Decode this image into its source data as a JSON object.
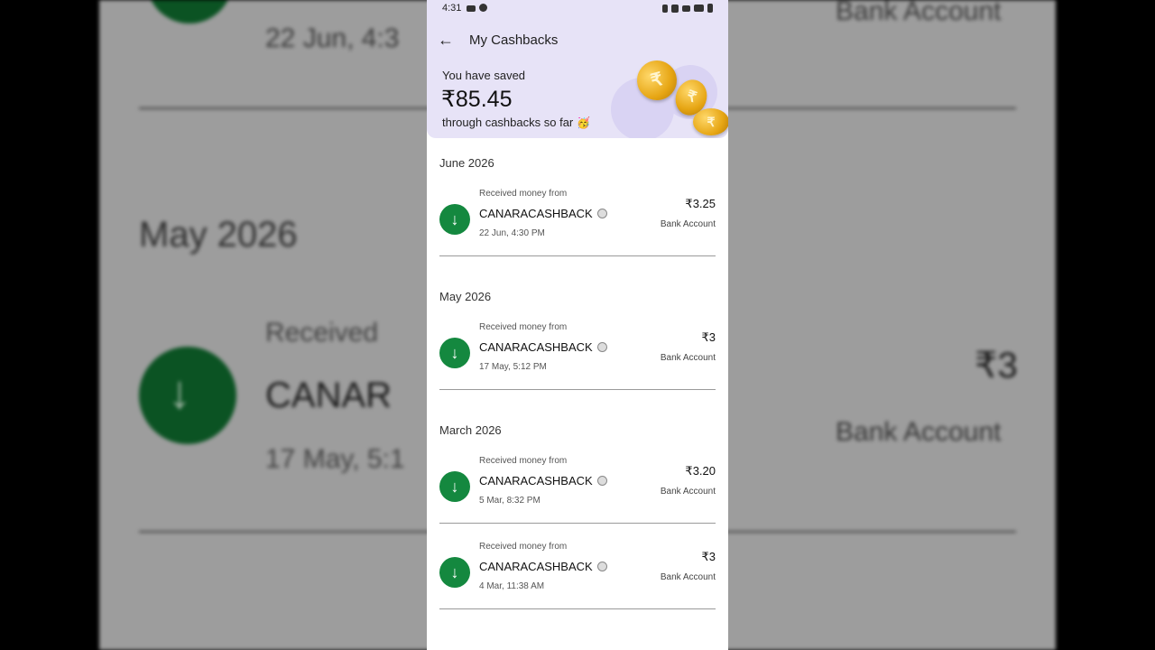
{
  "status_bar": {
    "time": "4:31"
  },
  "header": {
    "title": "My Cashbacks",
    "saved_label": "You have saved",
    "saved_amount": "₹85.45",
    "saved_sub": "through cashbacks so far"
  },
  "sections": [
    {
      "month": "June 2026",
      "items": [
        {
          "label": "Received money from",
          "name": "CANARACASHBACK",
          "date": "22 Jun, 4:30 PM",
          "amount": "₹3.25",
          "account": "Bank Account"
        }
      ]
    },
    {
      "month": "May 2026",
      "items": [
        {
          "label": "Received money from",
          "name": "CANARACASHBACK",
          "date": "17 May, 5:12 PM",
          "amount": "₹3",
          "account": "Bank Account"
        }
      ]
    },
    {
      "month": "March 2026",
      "items": [
        {
          "label": "Received money from",
          "name": "CANARACASHBACK",
          "date": "5 Mar, 8:32 PM",
          "amount": "₹3.20",
          "account": "Bank Account"
        },
        {
          "label": "Received money from",
          "name": "CANARACASHBACK",
          "date": "4 Mar, 11:38 AM",
          "amount": "₹3",
          "account": "Bank Account"
        }
      ]
    }
  ],
  "backdrop": {
    "bank_account_top": "Bank Account",
    "date_top": "22 Jun, 4:3",
    "month": "May 2026",
    "received": "Received",
    "name": "CANAR",
    "amount": "₹3",
    "bank_account": "Bank Account",
    "date": "17 May, 5:1"
  },
  "colors": {
    "accent_green": "#14883f",
    "header_bg": "#e7e3f7"
  }
}
